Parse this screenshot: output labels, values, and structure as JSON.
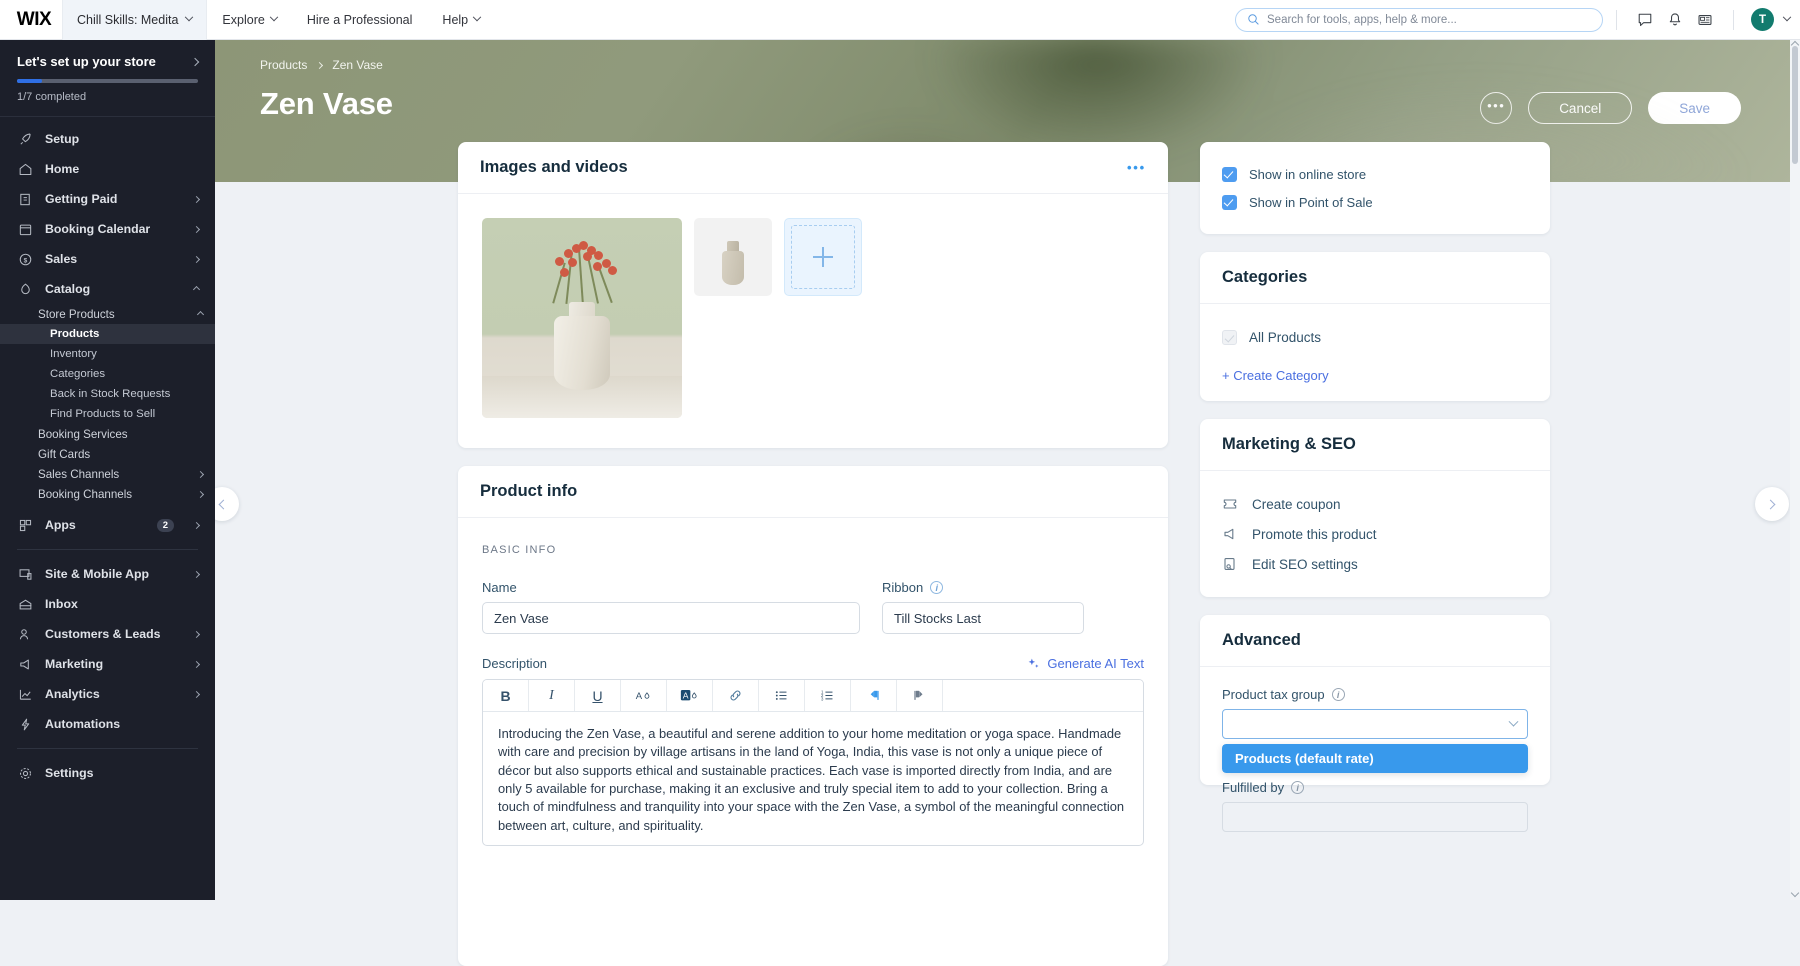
{
  "topbar": {
    "logo": "WIX",
    "site_name": "Chill Skills: Medita",
    "nav": [
      {
        "label": "Explore",
        "caret": true
      },
      {
        "label": "Hire a Professional",
        "caret": false
      },
      {
        "label": "Help",
        "caret": true
      }
    ],
    "search_placeholder": "Search for tools, apps, help & more...",
    "avatar_initial": "T"
  },
  "sidebar": {
    "setup": {
      "title": "Let's set up your store",
      "progress_text": "1/7 completed",
      "progress_percent": 14,
      "progress_color": "#2f6fe4"
    },
    "items": [
      {
        "label": "Setup",
        "icon": "rocket-icon",
        "arrow": "none"
      },
      {
        "label": "Home",
        "icon": "home-icon",
        "arrow": "none"
      },
      {
        "label": "Getting Paid",
        "icon": "payments-icon",
        "arrow": "right"
      },
      {
        "label": "Booking Calendar",
        "icon": "calendar-icon",
        "arrow": "right"
      },
      {
        "label": "Sales",
        "icon": "dollar-icon",
        "arrow": "right"
      },
      {
        "label": "Catalog",
        "icon": "catalog-icon",
        "arrow": "up"
      }
    ],
    "catalog_children": [
      {
        "label": "Store Products",
        "arrow": "up"
      }
    ],
    "store_products_children": [
      {
        "label": "Products",
        "active": true
      },
      {
        "label": "Inventory",
        "active": false
      },
      {
        "label": "Categories",
        "active": false
      },
      {
        "label": "Back in Stock Requests",
        "active": false
      },
      {
        "label": "Find Products to Sell",
        "active": false
      }
    ],
    "catalog_children_rest": [
      {
        "label": "Booking Services",
        "arrow": "none"
      },
      {
        "label": "Gift Cards",
        "arrow": "none"
      },
      {
        "label": "Sales Channels",
        "arrow": "right"
      },
      {
        "label": "Booking Channels",
        "arrow": "right"
      }
    ],
    "apps": {
      "label": "Apps",
      "icon": "apps-icon",
      "badge": "2",
      "arrow": "right"
    },
    "items_lower": [
      {
        "label": "Site & Mobile App",
        "icon": "monitor-icon",
        "arrow": "right"
      },
      {
        "label": "Inbox",
        "icon": "inbox-icon",
        "arrow": "none"
      },
      {
        "label": "Customers & Leads",
        "icon": "people-icon",
        "arrow": "right"
      },
      {
        "label": "Marketing",
        "icon": "megaphone-icon",
        "arrow": "right"
      },
      {
        "label": "Analytics",
        "icon": "chart-icon",
        "arrow": "right"
      },
      {
        "label": "Automations",
        "icon": "bolt-icon",
        "arrow": "none"
      }
    ],
    "settings": {
      "label": "Settings",
      "icon": "gear-icon"
    }
  },
  "hero": {
    "breadcrumb": [
      "Products",
      "Zen Vase"
    ],
    "title": "Zen Vase",
    "more_label": "•••",
    "cancel_label": "Cancel",
    "save_label": "Save"
  },
  "media_card": {
    "title": "Images and videos",
    "more_label": "•••",
    "add_label": "+"
  },
  "product_info": {
    "title": "Product info",
    "section_label": "BASIC INFO",
    "name_label": "Name",
    "name_value": "Zen Vase",
    "ribbon_label": "Ribbon",
    "ribbon_value": "Till Stocks Last",
    "description_label": "Description",
    "ai_link": "Generate AI Text",
    "toolbar": [
      {
        "name": "bold-icon",
        "glyph": "B"
      },
      {
        "name": "italic-icon",
        "glyph": "I"
      },
      {
        "name": "underline-icon",
        "glyph": "U"
      },
      {
        "name": "text-color-icon",
        "glyph": "A"
      },
      {
        "name": "highlight-color-icon",
        "glyph": "A"
      },
      {
        "name": "link-icon",
        "glyph": "🔗"
      },
      {
        "name": "bulleted-list-icon",
        "glyph": "☰"
      },
      {
        "name": "numbered-list-icon",
        "glyph": "☰"
      },
      {
        "name": "align-left-icon",
        "glyph": "¶"
      },
      {
        "name": "align-right-icon",
        "glyph": "¶"
      }
    ],
    "description_text": "Introducing the Zen Vase, a beautiful and serene addition to your home meditation or yoga space. Handmade with care and precision by village artisans in the land of Yoga, India, this vase is not only a unique piece of décor but also supports ethical and sustainable practices. Each vase is imported directly from India, and are only 5 available for purchase, making it an exclusive and truly special item to add to your collection. Bring a touch of mindfulness and tranquility into your space with the Zen Vase, a symbol of the meaningful connection between art, culture, and spirituality."
  },
  "visibility": {
    "options": [
      {
        "label": "Show in online store",
        "checked": true
      },
      {
        "label": "Show in Point of Sale",
        "checked": true
      }
    ]
  },
  "categories": {
    "title": "Categories",
    "items": [
      {
        "label": "All Products",
        "checked": true,
        "disabled": true
      }
    ],
    "create_link": "+ Create Category"
  },
  "marketing": {
    "title": "Marketing & SEO",
    "items": [
      {
        "label": "Create coupon",
        "icon": "coupon-icon"
      },
      {
        "label": "Promote this product",
        "icon": "megaphone-icon"
      },
      {
        "label": "Edit SEO settings",
        "icon": "seo-icon"
      }
    ]
  },
  "advanced": {
    "title": "Advanced",
    "tax_label": "Product tax group",
    "tax_value": "",
    "dropdown_options": [
      "Products (default rate)"
    ],
    "fulfilled_label": "Fulfilled by"
  },
  "colors": {
    "accent_blue": "#3899ec",
    "link_blue": "#4a6fe0",
    "sidebar_bg": "#1c1f2a",
    "hero_green": "#8d9677"
  }
}
